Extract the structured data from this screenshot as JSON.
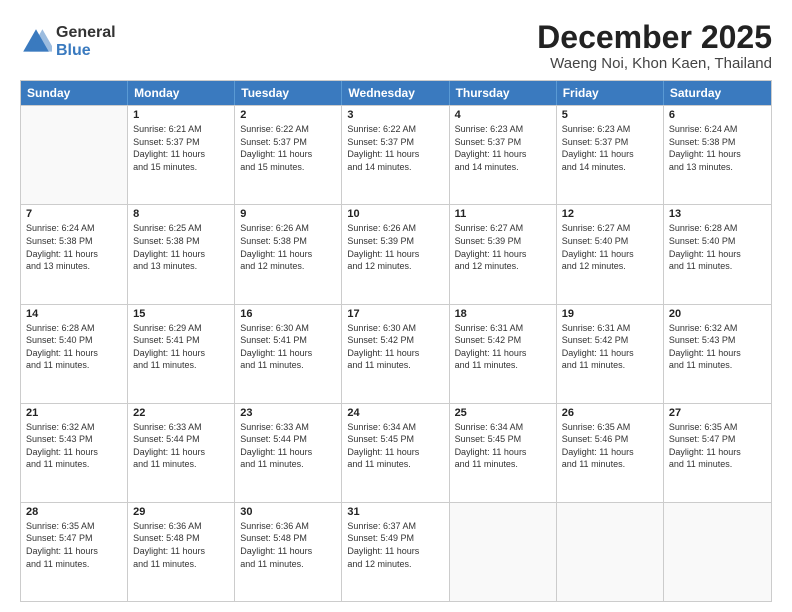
{
  "logo": {
    "general": "General",
    "blue": "Blue"
  },
  "title": "December 2025",
  "location": "Waeng Noi, Khon Kaen, Thailand",
  "days_of_week": [
    "Sunday",
    "Monday",
    "Tuesday",
    "Wednesday",
    "Thursday",
    "Friday",
    "Saturday"
  ],
  "weeks": [
    [
      {
        "day": "",
        "sunrise": "",
        "sunset": "",
        "daylight": ""
      },
      {
        "day": "1",
        "sunrise": "Sunrise: 6:21 AM",
        "sunset": "Sunset: 5:37 PM",
        "daylight": "Daylight: 11 hours and 15 minutes."
      },
      {
        "day": "2",
        "sunrise": "Sunrise: 6:22 AM",
        "sunset": "Sunset: 5:37 PM",
        "daylight": "Daylight: 11 hours and 15 minutes."
      },
      {
        "day": "3",
        "sunrise": "Sunrise: 6:22 AM",
        "sunset": "Sunset: 5:37 PM",
        "daylight": "Daylight: 11 hours and 14 minutes."
      },
      {
        "day": "4",
        "sunrise": "Sunrise: 6:23 AM",
        "sunset": "Sunset: 5:37 PM",
        "daylight": "Daylight: 11 hours and 14 minutes."
      },
      {
        "day": "5",
        "sunrise": "Sunrise: 6:23 AM",
        "sunset": "Sunset: 5:37 PM",
        "daylight": "Daylight: 11 hours and 14 minutes."
      },
      {
        "day": "6",
        "sunrise": "Sunrise: 6:24 AM",
        "sunset": "Sunset: 5:38 PM",
        "daylight": "Daylight: 11 hours and 13 minutes."
      }
    ],
    [
      {
        "day": "7",
        "sunrise": "Sunrise: 6:24 AM",
        "sunset": "Sunset: 5:38 PM",
        "daylight": "Daylight: 11 hours and 13 minutes."
      },
      {
        "day": "8",
        "sunrise": "Sunrise: 6:25 AM",
        "sunset": "Sunset: 5:38 PM",
        "daylight": "Daylight: 11 hours and 13 minutes."
      },
      {
        "day": "9",
        "sunrise": "Sunrise: 6:26 AM",
        "sunset": "Sunset: 5:38 PM",
        "daylight": "Daylight: 11 hours and 12 minutes."
      },
      {
        "day": "10",
        "sunrise": "Sunrise: 6:26 AM",
        "sunset": "Sunset: 5:39 PM",
        "daylight": "Daylight: 11 hours and 12 minutes."
      },
      {
        "day": "11",
        "sunrise": "Sunrise: 6:27 AM",
        "sunset": "Sunset: 5:39 PM",
        "daylight": "Daylight: 11 hours and 12 minutes."
      },
      {
        "day": "12",
        "sunrise": "Sunrise: 6:27 AM",
        "sunset": "Sunset: 5:40 PM",
        "daylight": "Daylight: 11 hours and 12 minutes."
      },
      {
        "day": "13",
        "sunrise": "Sunrise: 6:28 AM",
        "sunset": "Sunset: 5:40 PM",
        "daylight": "Daylight: 11 hours and 11 minutes."
      }
    ],
    [
      {
        "day": "14",
        "sunrise": "Sunrise: 6:28 AM",
        "sunset": "Sunset: 5:40 PM",
        "daylight": "Daylight: 11 hours and 11 minutes."
      },
      {
        "day": "15",
        "sunrise": "Sunrise: 6:29 AM",
        "sunset": "Sunset: 5:41 PM",
        "daylight": "Daylight: 11 hours and 11 minutes."
      },
      {
        "day": "16",
        "sunrise": "Sunrise: 6:30 AM",
        "sunset": "Sunset: 5:41 PM",
        "daylight": "Daylight: 11 hours and 11 minutes."
      },
      {
        "day": "17",
        "sunrise": "Sunrise: 6:30 AM",
        "sunset": "Sunset: 5:42 PM",
        "daylight": "Daylight: 11 hours and 11 minutes."
      },
      {
        "day": "18",
        "sunrise": "Sunrise: 6:31 AM",
        "sunset": "Sunset: 5:42 PM",
        "daylight": "Daylight: 11 hours and 11 minutes."
      },
      {
        "day": "19",
        "sunrise": "Sunrise: 6:31 AM",
        "sunset": "Sunset: 5:42 PM",
        "daylight": "Daylight: 11 hours and 11 minutes."
      },
      {
        "day": "20",
        "sunrise": "Sunrise: 6:32 AM",
        "sunset": "Sunset: 5:43 PM",
        "daylight": "Daylight: 11 hours and 11 minutes."
      }
    ],
    [
      {
        "day": "21",
        "sunrise": "Sunrise: 6:32 AM",
        "sunset": "Sunset: 5:43 PM",
        "daylight": "Daylight: 11 hours and 11 minutes."
      },
      {
        "day": "22",
        "sunrise": "Sunrise: 6:33 AM",
        "sunset": "Sunset: 5:44 PM",
        "daylight": "Daylight: 11 hours and 11 minutes."
      },
      {
        "day": "23",
        "sunrise": "Sunrise: 6:33 AM",
        "sunset": "Sunset: 5:44 PM",
        "daylight": "Daylight: 11 hours and 11 minutes."
      },
      {
        "day": "24",
        "sunrise": "Sunrise: 6:34 AM",
        "sunset": "Sunset: 5:45 PM",
        "daylight": "Daylight: 11 hours and 11 minutes."
      },
      {
        "day": "25",
        "sunrise": "Sunrise: 6:34 AM",
        "sunset": "Sunset: 5:45 PM",
        "daylight": "Daylight: 11 hours and 11 minutes."
      },
      {
        "day": "26",
        "sunrise": "Sunrise: 6:35 AM",
        "sunset": "Sunset: 5:46 PM",
        "daylight": "Daylight: 11 hours and 11 minutes."
      },
      {
        "day": "27",
        "sunrise": "Sunrise: 6:35 AM",
        "sunset": "Sunset: 5:47 PM",
        "daylight": "Daylight: 11 hours and 11 minutes."
      }
    ],
    [
      {
        "day": "28",
        "sunrise": "Sunrise: 6:35 AM",
        "sunset": "Sunset: 5:47 PM",
        "daylight": "Daylight: 11 hours and 11 minutes."
      },
      {
        "day": "29",
        "sunrise": "Sunrise: 6:36 AM",
        "sunset": "Sunset: 5:48 PM",
        "daylight": "Daylight: 11 hours and 11 minutes."
      },
      {
        "day": "30",
        "sunrise": "Sunrise: 6:36 AM",
        "sunset": "Sunset: 5:48 PM",
        "daylight": "Daylight: 11 hours and 11 minutes."
      },
      {
        "day": "31",
        "sunrise": "Sunrise: 6:37 AM",
        "sunset": "Sunset: 5:49 PM",
        "daylight": "Daylight: 11 hours and 12 minutes."
      },
      {
        "day": "",
        "sunrise": "",
        "sunset": "",
        "daylight": ""
      },
      {
        "day": "",
        "sunrise": "",
        "sunset": "",
        "daylight": ""
      },
      {
        "day": "",
        "sunrise": "",
        "sunset": "",
        "daylight": ""
      }
    ]
  ]
}
